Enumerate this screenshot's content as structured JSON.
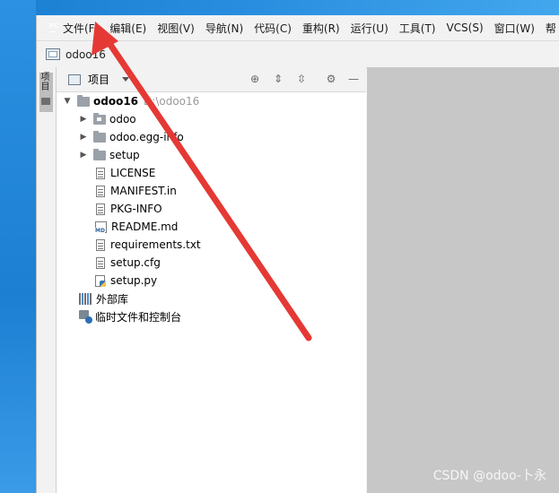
{
  "app": {
    "logo_text": "PC"
  },
  "menubar": {
    "items": [
      "文件(F)",
      "编辑(E)",
      "视图(V)",
      "导航(N)",
      "代码(C)",
      "重构(R)",
      "运行(U)",
      "工具(T)",
      "VCS(S)",
      "窗口(W)",
      "帮"
    ]
  },
  "navbar": {
    "project": "odoo16"
  },
  "toolstrip": {
    "tab_label": "项目"
  },
  "panel": {
    "title": "项目"
  },
  "tree": {
    "root": {
      "name": "odoo16",
      "path": "D:\\odoo16"
    },
    "folders": [
      "odoo",
      "odoo.egg-info",
      "setup"
    ],
    "files": [
      "LICENSE",
      "MANIFEST.in",
      "PKG-INFO",
      "README.md",
      "requirements.txt",
      "setup.cfg",
      "setup.py"
    ],
    "external_libs": "外部库",
    "scratches": "临时文件和控制台"
  },
  "icons": {
    "md_badge": "MD"
  },
  "watermark": "CSDN @odoo-卜永",
  "colors": {
    "annotation_arrow": "#e53935",
    "editor_bg": "#c7c7c7"
  }
}
